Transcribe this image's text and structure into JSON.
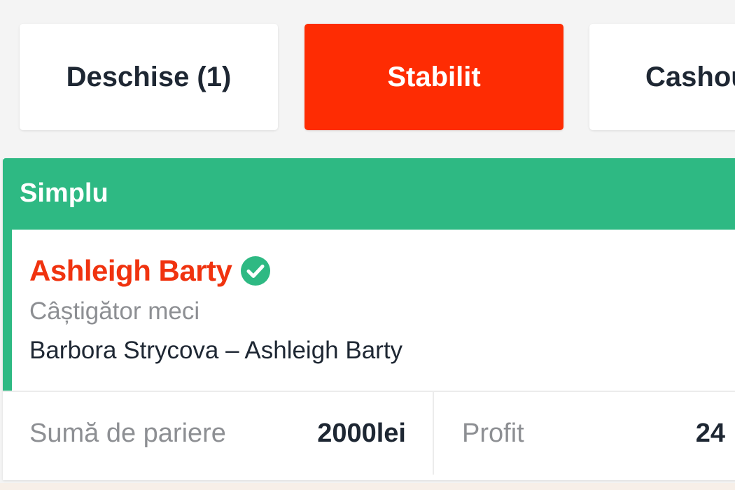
{
  "tabs": [
    {
      "label": "Deschise (1)",
      "active": false
    },
    {
      "label": "Stabilit",
      "active": true
    },
    {
      "label": "Cashou",
      "active": false
    }
  ],
  "bet": {
    "type_label": "Simplu",
    "selection": "Ashleigh Barty",
    "status_icon": "check-circle-icon",
    "market": "Câștigător meci",
    "event": "Barbora Strycova – Ashleigh Barty",
    "stake_label": "Sumă de pariere",
    "stake_value": "2000lei",
    "profit_label": "Profit",
    "profit_value": "24"
  },
  "colors": {
    "active_tab": "#fe2c03",
    "header_green": "#2eb983",
    "selection_red": "#f0330f",
    "text_dark": "#1e2733",
    "text_muted": "#8d8f93"
  }
}
